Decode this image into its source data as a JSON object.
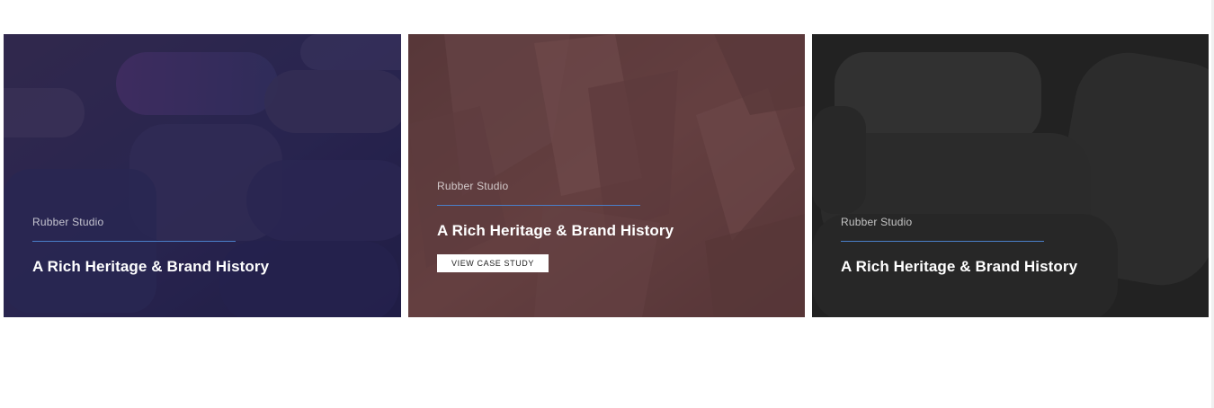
{
  "cards": [
    {
      "category": "Rubber Studio",
      "title": "A Rich Heritage & Brand History",
      "theme_color": "#2a2550"
    },
    {
      "category": "Rubber Studio",
      "title": "A Rich Heritage & Brand History",
      "button_label": "VIEW CASE STUDY",
      "theme_color": "#5a3a3c"
    },
    {
      "category": "Rubber Studio",
      "title": "A Rich Heritage & Brand History",
      "theme_color": "#2f2f2f"
    }
  ],
  "accent_color": "#4a7fc9"
}
